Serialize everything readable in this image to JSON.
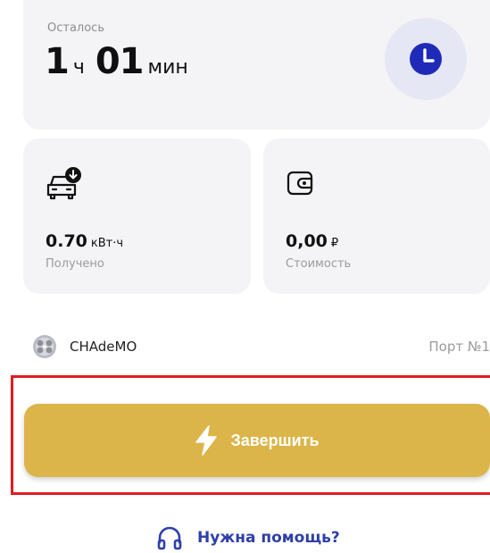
{
  "remaining": {
    "label": "Осталось",
    "hours_value": "1",
    "hours_unit": "ч",
    "minutes_value": "01",
    "minutes_unit": "мин",
    "icon": "clock-icon"
  },
  "energy": {
    "value": "0.70",
    "unit": "кВт·ч",
    "label": "Получено",
    "icon": "car-charge-icon"
  },
  "cost": {
    "value": "0,00",
    "unit": "₽",
    "label": "Стоимость",
    "icon": "wallet-icon"
  },
  "connector": {
    "name": "CHAdeMO",
    "port": "Порт №1",
    "icon": "connector-plug-icon"
  },
  "finish_button": {
    "label": "Завершить",
    "icon": "lightning-icon"
  },
  "help": {
    "label": "Нужна помощь?",
    "icon": "headphones-icon"
  },
  "colors": {
    "accent_gold": "#dbb54a",
    "primary_blue": "#2e3fa8",
    "card_bg": "#f4f4f6",
    "highlight_red": "#e01b24"
  }
}
